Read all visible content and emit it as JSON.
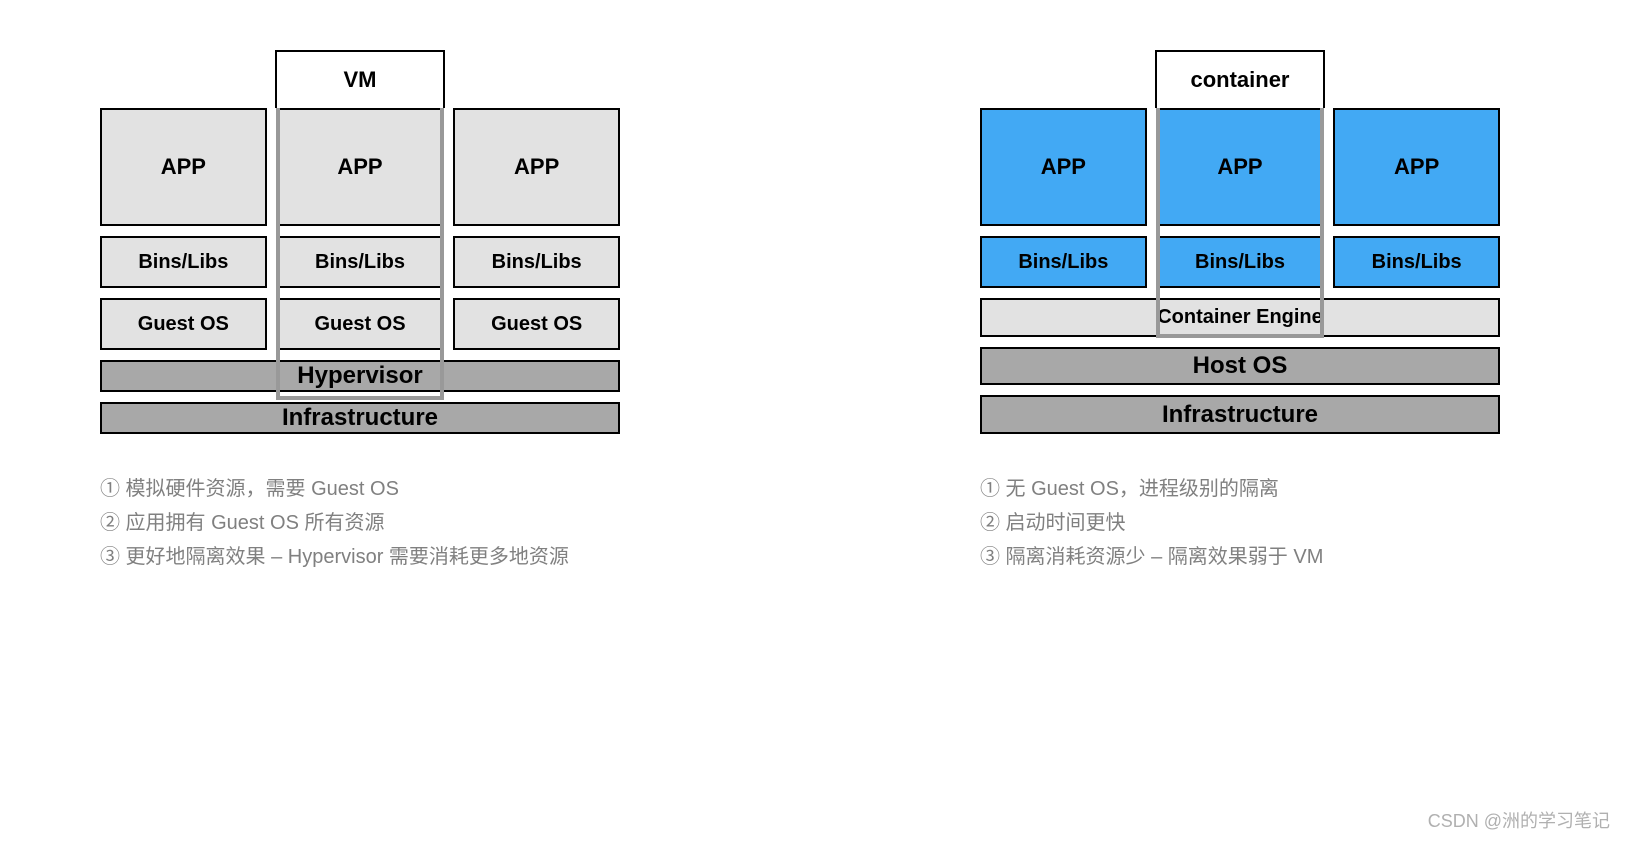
{
  "left": {
    "header": "VM",
    "apps": [
      "APP",
      "APP",
      "APP"
    ],
    "bins": [
      "Bins/Libs",
      "Bins/Libs",
      "Bins/Libs"
    ],
    "guests": [
      "Guest OS",
      "Guest OS",
      "Guest OS"
    ],
    "hypervisor": "Hypervisor",
    "infra": "Infrastructure",
    "notes": [
      "① 模拟硬件资源，需要 Guest OS",
      "② 应用拥有 Guest OS 所有资源",
      "③ 更好地隔离效果 – Hypervisor 需要消耗更多地资源"
    ]
  },
  "right": {
    "header": "container",
    "apps": [
      "APP",
      "APP",
      "APP"
    ],
    "bins": [
      "Bins/Libs",
      "Bins/Libs",
      "Bins/Libs"
    ],
    "engine": "Container Engine",
    "hostos": "Host OS",
    "infra": "Infrastructure",
    "notes": [
      "① 无 Guest OS，进程级别的隔离",
      "② 启动时间更快",
      "③ 隔离消耗资源少 – 隔离效果弱于 VM"
    ]
  },
  "watermark": "CSDN @洲的学习笔记"
}
